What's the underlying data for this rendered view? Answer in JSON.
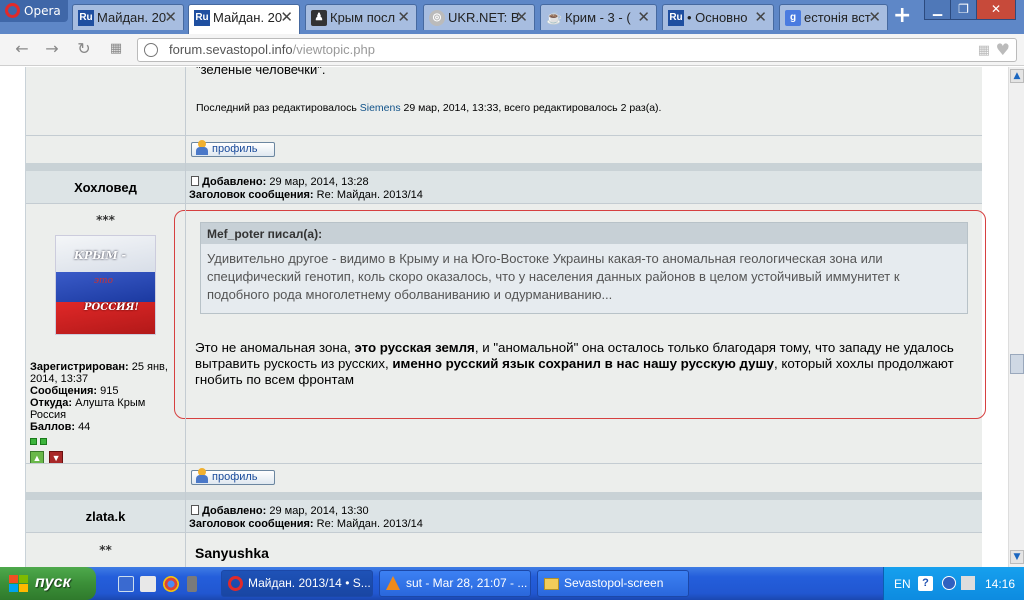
{
  "browser": {
    "menu_label": "Opera",
    "tabs": [
      {
        "favicon": "Ru",
        "title": "Майдан. 20",
        "color": "#1f4fa0"
      },
      {
        "favicon": "Ru",
        "title": "Майдан. 20",
        "color": "#1f4fa0"
      },
      {
        "favicon": "torch",
        "title": "Крым посл",
        "color": "#333333"
      },
      {
        "favicon": "ukrnet",
        "title": "UKR.NET: В",
        "color": "#888888"
      },
      {
        "favicon": "cup",
        "title": "Крим - 3 - (",
        "color": "#7a4a20"
      },
      {
        "favicon": "Ru",
        "title": "• Основно",
        "color": "#1f4fa0"
      },
      {
        "favicon": "g",
        "title": "естонія вст",
        "color": "#4a7be0"
      }
    ],
    "active_tab_index": 1,
    "address": {
      "host": "forum.sevastopol.info",
      "path": "/viewtopic.php"
    }
  },
  "post1_tail": {
    "text_fragment": "\"зеленые человечки\".",
    "edit_prefix": "Последний раз редактировалось",
    "edit_user": "Siemens",
    "edit_suffix": "29 мар, 2014, 13:33, всего редактировалось 2 раз(а).",
    "profile_label": "профиль"
  },
  "post2": {
    "author": "Хохловед",
    "rank": "***",
    "added_label": "Добавлено:",
    "added_value": "29 мар, 2014, 13:28",
    "subject_label": "Заголовок сообщения:",
    "subject_value": "Re: Майдан. 2013/14",
    "avatar_text": {
      "line1": "КРЫМ -",
      "line2": "это",
      "line3": "РОССИЯ!"
    },
    "profile": {
      "registered_label": "Зарегистрирован:",
      "registered_value": "25 янв, 2014, 13:37",
      "messages_label": "Сообщения:",
      "messages_value": "915",
      "from_label": "Откуда:",
      "from_value": "Алушта Крым Россия",
      "points_label": "Баллов:",
      "points_value": "44"
    },
    "quote": {
      "header": "Mef_poter писал(а):",
      "body": "Удивительно другое - видимо в Крыму и на Юго-Востоке Украины какая-то аномальная геологическая зона или специфический генотип, коль скоро оказалось, что у населения данных районов в целом устойчивый иммунитет к подобного рода многолетнему оболваниванию и одурманиванию..."
    },
    "message": {
      "p1": "Это не аномальная зона, ",
      "b1": "это русская земля",
      "p2": ", и \"аномальной\" она осталось только благодаря тому, что западу не удалось вытравить рускость из русских, ",
      "b2": "именно русский язык сохранил в нас нашу русскую душу",
      "p3": ", который хохлы продолжают гнобить по всем фронтам"
    },
    "profile_label": "профиль"
  },
  "post3": {
    "author": "zlata.k",
    "rank": "**",
    "added_label": "Добавлено:",
    "added_value": "29 мар, 2014, 13:30",
    "subject_label": "Заголовок сообщения:",
    "subject_value": "Re: Майдан. 2013/14",
    "first_line": "Sanyushka"
  },
  "taskbar": {
    "start_label": "пуск",
    "tasks": [
      {
        "label": "Майдан. 2013/14 • S...",
        "icon": "opera"
      },
      {
        "label": "sut - Mar 28, 21:07 - ...",
        "icon": "vlc"
      },
      {
        "label": "Sevastopol-screen",
        "icon": "folder"
      }
    ],
    "lang": "EN",
    "help_glyph": "?",
    "clock": "14:16"
  }
}
